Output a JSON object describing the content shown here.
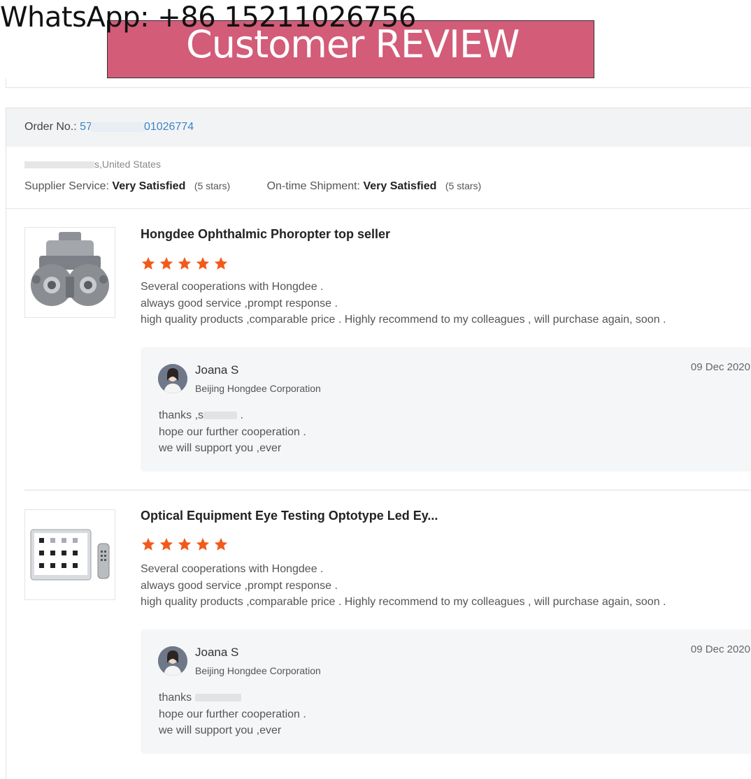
{
  "watermark": {
    "text": "WhatsApp: +86 15211026756"
  },
  "banner": {
    "text": "Customer REVIEW",
    "color": "#d35c79"
  },
  "order": {
    "label": "Order No.:",
    "number_prefix": "57",
    "number_suffix": "01026774",
    "location": "s,United States"
  },
  "ratings": {
    "supplier_label": "Supplier Service:",
    "supplier_value": "Very Satisfied",
    "supplier_stars": "(5 stars)",
    "shipment_label": "On-time Shipment:",
    "shipment_value": "Very Satisfied",
    "shipment_stars": "(5 stars)"
  },
  "reviews": [
    {
      "title": "Hongdee Ophthalmic Phoropter top seller",
      "rating": 5,
      "comment": [
        "Several cooperations with Hongdee .",
        "always good service ,prompt response .",
        "high quality products ,comparable price . Highly recommend to my colleagues , will purchase again, soon ."
      ],
      "reply": {
        "name": "Joana S",
        "company": "Beijing Hongdee Corporation",
        "date": "09 Dec 2020",
        "line1": "thanks ,s",
        "line1_end": " .",
        "line2": "hope our further cooperation .",
        "line3": "we will support you ,ever"
      }
    },
    {
      "title": "Optical Equipment Eye Testing Optotype Led Ey...",
      "rating": 5,
      "comment": [
        "Several cooperations with Hongdee .",
        "always good service ,prompt response .",
        "high quality products ,comparable price . Highly recommend to my colleagues , will purchase again, soon ."
      ],
      "reply": {
        "name": "Joana S",
        "company": "Beijing Hongdee Corporation",
        "date": "09 Dec 2020",
        "line1": "thanks",
        "line1_end": "",
        "line2": "hope our further cooperation .",
        "line3": "we will support you ,ever"
      }
    }
  ],
  "icons": {
    "star": "star-icon",
    "star_color": "#f25a1b"
  }
}
